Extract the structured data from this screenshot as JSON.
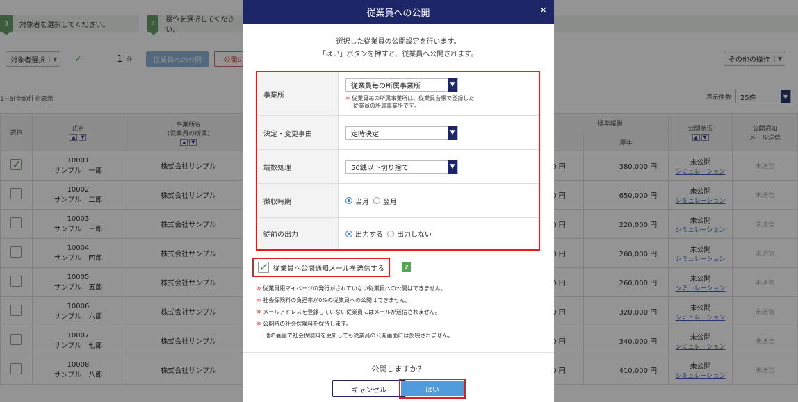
{
  "background": {
    "steps": [
      {
        "num": "3",
        "label": "対象者を選択してください。"
      },
      {
        "num": "4",
        "label": "操作を選択してください。"
      }
    ],
    "toolbar": {
      "select_label": "対象者選択",
      "count": "1",
      "count_unit": "件",
      "publish_label": "従業員への公開",
      "unpublish_label": "公開の",
      "other_ops_label": "その他の操作"
    },
    "range_text": "1~8(全8)件を表示",
    "per_page_label": "表示件数",
    "per_page_value": "25件",
    "columns": {
      "select": "選択",
      "name": "氏名",
      "office": "事業所名",
      "office_sub": "(従業員の所属)",
      "standard_pay": "標準報酬",
      "kosei": "厚年",
      "status": "公開状況",
      "mail": "公開通知",
      "mail2": "メール送信"
    },
    "rows": [
      {
        "id": "10001",
        "name": "サンプル　一郎",
        "office": "株式会社サンプル",
        "pay_left": "0 円",
        "kosei": "380,000 円",
        "status": "未公開",
        "sim": "シミュレーション",
        "mail": "未送信",
        "checked": true
      },
      {
        "id": "10002",
        "name": "サンプル　二郎",
        "office": "株式会社サンプル",
        "pay_left": "0 円",
        "kosei": "650,000 円",
        "status": "未公開",
        "sim": "シミュレーション",
        "mail": "未送信",
        "checked": false
      },
      {
        "id": "10003",
        "name": "サンプル　三郎",
        "office": "株式会社サンプル",
        "pay_left": "0 円",
        "kosei": "220,000 円",
        "status": "未公開",
        "sim": "シミュレーション",
        "mail": "未送信",
        "checked": false
      },
      {
        "id": "10004",
        "name": "サンプル　四郎",
        "office": "株式会社サンプル",
        "pay_left": "0 円",
        "kosei": "260,000 円",
        "status": "未公開",
        "sim": "シミュレーション",
        "mail": "未送信",
        "checked": false
      },
      {
        "id": "10005",
        "name": "サンプル　五郎",
        "office": "株式会社サンプル",
        "pay_left": "0 円",
        "kosei": "260,000 円",
        "status": "未公開",
        "sim": "シミュレーション",
        "mail": "未送信",
        "checked": false
      },
      {
        "id": "10006",
        "name": "サンプル　六郎",
        "office": "株式会社サンプル",
        "pay_left": "0 円",
        "kosei": "320,000 円",
        "status": "未公開",
        "sim": "シミュレーション",
        "mail": "未送信",
        "checked": false
      },
      {
        "id": "10007",
        "name": "サンプル　七郎",
        "office": "株式会社サンプル",
        "pay_left": "0 円",
        "kosei": "340,000 円",
        "status": "未公開",
        "sim": "シミュレーション",
        "mail": "未送信",
        "checked": false
      },
      {
        "id": "10008",
        "name": "サンプル　八郎",
        "office": "株式会社サンプル",
        "pay_left": "0 円",
        "kosei": "410,000 円",
        "status": "未公開",
        "sim": "シミュレーション",
        "mail": "未送信",
        "checked": false
      }
    ]
  },
  "modal": {
    "title": "従業員への公開",
    "intro_line1": "選択した従業員の公開設定を行います。",
    "intro_line2": "「はい」ボタンを押すと、従業員へ公開されます。",
    "fields": {
      "office": {
        "label": "事業所",
        "value": "従業員毎の所属事業所",
        "note_line1": "従業員毎の所属事業所は、従業員台帳で登録した",
        "note_line2": "従業員の所属事業所です。"
      },
      "reason": {
        "label": "決定・変更事由",
        "value": "定時決定"
      },
      "rounding": {
        "label": "端数処理",
        "value": "50銭以下切り捨て"
      },
      "collection": {
        "label": "徴収時期",
        "options": [
          "当月",
          "翌月"
        ],
        "selected": "当月"
      },
      "previous": {
        "label": "従前の出力",
        "options": [
          "出力する",
          "出力しない"
        ],
        "selected": "出力する"
      }
    },
    "mail_checkbox_label": "従業員へ公開通知メールを送信する",
    "help_icon_glyph": "?",
    "warnings": [
      "従業員用マイページの発行がされていない従業員への公開はできません。",
      "社会保険料の負担率が0%の従業員への公開はできません。",
      "メールアドレスを登録していない従業員にはメールが送信されません。",
      "公開時の社会保険料を保持します。"
    ],
    "warning_continuation": "他の画面で社会保険料を更新しても従業員の公開画面には反映されません。",
    "confirm_question": "公開しますか？",
    "cancel_label": "キャンセル",
    "yes_label": "はい",
    "colors": {
      "header": "#1d2666",
      "accent_red": "#e02020",
      "yes_button": "#4f9bdc"
    }
  }
}
